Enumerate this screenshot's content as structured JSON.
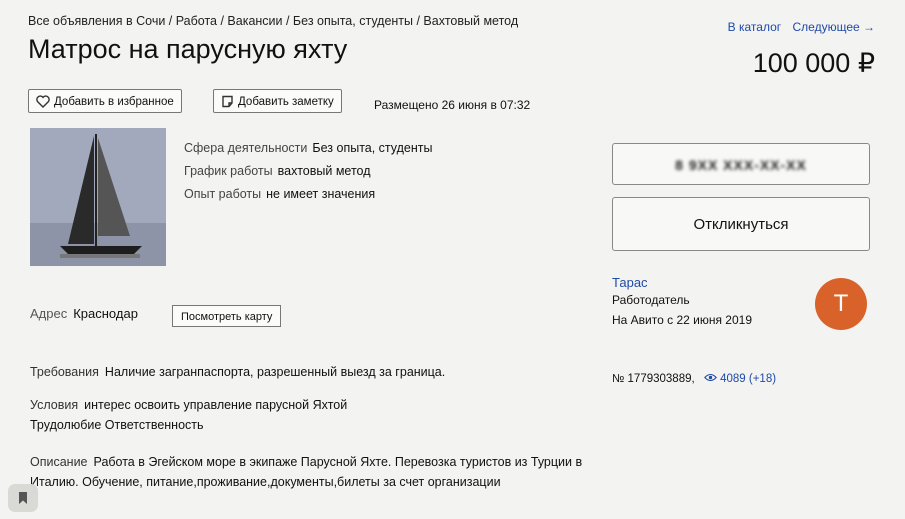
{
  "breadcrumbs": "Все объявления в Сочи / Работа / Вакансии / Без опыта, студенты / Вахтовый метод",
  "top_links": {
    "catalog": "В каталог",
    "next": "Следующее →"
  },
  "listing": {
    "title": "Матрос на парусную яхту",
    "price": "100 000 ₽",
    "posted": "Размещено 26 июня в 07:32",
    "number_stats": "№ 1779303889,",
    "views": "4089 (+18)"
  },
  "buttons": {
    "favorite": "Добавить в избранное",
    "note": "Добавить заметку",
    "phone": "8 9ХХ ХХХ-ХХ-ХХ",
    "reply": "Откликнуться",
    "map": "Посмотреть карту"
  },
  "facts": [
    {
      "key": "Сфера деятельности",
      "value": "Без опыта, студенты"
    },
    {
      "key": "График работы",
      "value": "вахтовый метод"
    },
    {
      "key": "Опыт работы",
      "value": "не имеет значения"
    }
  ],
  "address": {
    "key": "Адрес",
    "value": "Краснодар"
  },
  "seller": {
    "name": "Тарас",
    "role": "Работодатель",
    "since": "На Авито с 22 июня 2019",
    "avatar_letter": "Т",
    "avatar_color": "#d8622a"
  },
  "requirements": {
    "key": "Требования",
    "value": "Наличие загранпаспорта, разрешенный выезд за граница."
  },
  "conditions": {
    "key": "Условия",
    "value": "интерес освоить управление парусной Яхтой"
  },
  "diligence": "Трудолюбие  Ответственность",
  "description": {
    "key": "Описание",
    "value": "Работа в Эгейском море в экипаже Парусной Яхте. Перевозка туристов из Турции в Италию. Обучение, питание,проживание,документы,билеты за счет организации"
  },
  "icons": {
    "favorite": "heart-icon",
    "note": "note-icon",
    "views": "eye-icon",
    "bookmark": "bookmark-icon"
  },
  "colors": {
    "link": "#1f4aa8",
    "avatar": "#d8622a"
  }
}
